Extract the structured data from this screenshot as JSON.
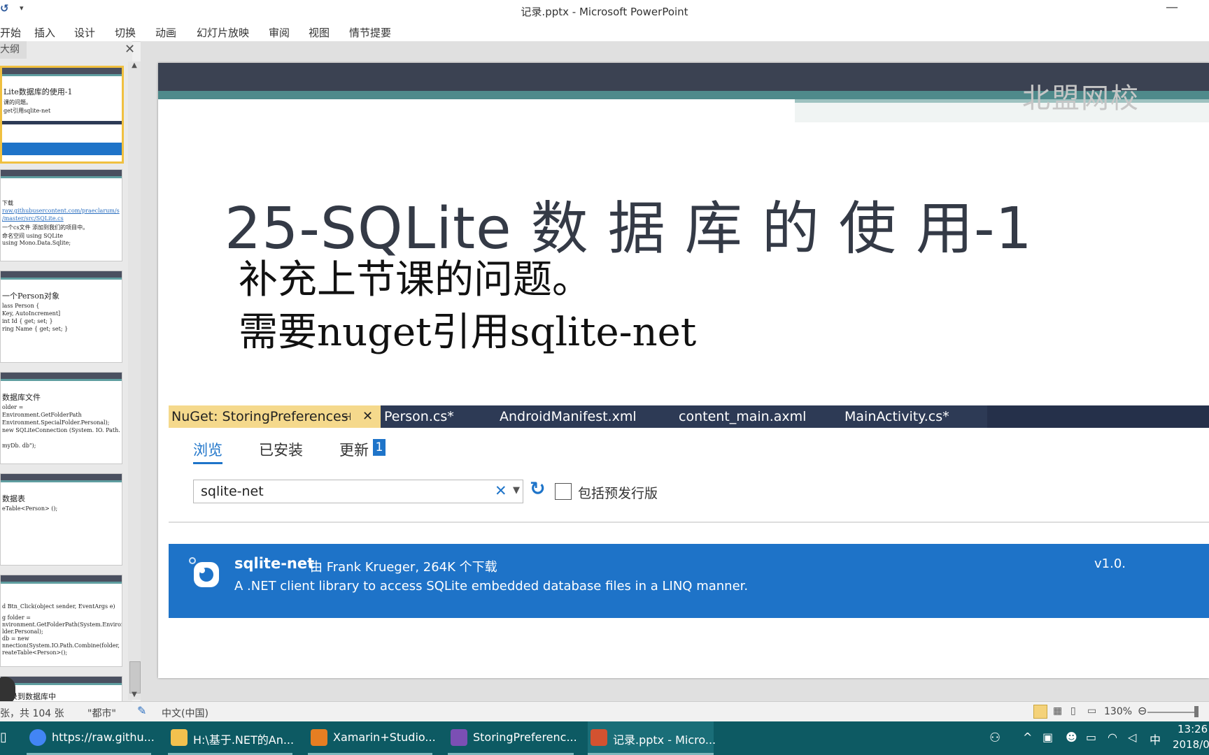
{
  "window": {
    "title": "记录.pptx - Microsoft PowerPoint"
  },
  "ribbon": {
    "tabs": [
      "开始",
      "插入",
      "设计",
      "切换",
      "动画",
      "幻灯片放映",
      "审阅",
      "视图",
      "情节提要"
    ]
  },
  "left_panel": {
    "tab_label": "大纲",
    "thumbs": [
      {
        "lines": [
          "Lite数据库的使用-1",
          "课的问题。",
          "get引用sqlite-net"
        ]
      },
      {
        "lines": [
          "下载",
          "raw.githubusercontent.com/praeclarum/s",
          "/master/src/SQLite.cs",
          "一个cs文件 添加到我们的项目中。",
          "命名空间 using SQLite",
          "using Mono.Data.Sqlite;"
        ]
      },
      {
        "lines": [
          "一个Person对象",
          "lass Person {",
          "Key, AutoIncrement]",
          "int Id { get; set; }",
          "ring Name { get; set; }"
        ]
      },
      {
        "lines": [
          "数据库文件",
          "older =",
          "Environment.GetFolderPath",
          "Environment.SpecialFolder.Personal);",
          "new SQLiteConnection (System. IO. Path.",
          "myDb. db\");"
        ]
      },
      {
        "lines": [
          "数据表",
          "eTable<Person> ();"
        ]
      },
      {
        "lines": [
          "d Btn_Click(object sender, EventArgs e)",
          "g folder =",
          "nvironment.GetFolderPath(System.Environment",
          "lder.Personal);",
          "db = new",
          "nnection(System.IO.Path.Combine(folder,",
          "reateTable<Person>();"
        ]
      },
      {
        "lines": [
          "记录到数据库中"
        ]
      }
    ]
  },
  "slide": {
    "brand": "北盟网校",
    "title": "25-SQLite 数 据 库 的 使 用-1",
    "bullets": [
      "补充上节课的问题。",
      "需要nuget引用sqlite-net"
    ],
    "nuget": {
      "doc_tabs": [
        "NuGet: StoringPreferences",
        "Person.cs*",
        "AndroidManifest.xml",
        "content_main.axml",
        "MainActivity.cs*"
      ],
      "pin_icon": "⊣",
      "nav_tabs": {
        "browse": "浏览",
        "installed": "已安装",
        "updates": "更新",
        "update_count": "1"
      },
      "search_value": "sqlite-net",
      "prerelease_label": "包括预发行版",
      "package": {
        "name": "sqlite-net",
        "meta": "由 Frank Krueger, 264K 个下载",
        "description": "A .NET client library to access SQLite embedded database files in a LINQ manner.",
        "version": "v1.0."
      }
    }
  },
  "status": {
    "slide_info": "张，共 104 张",
    "theme": "\"都市\"",
    "language": "中文(中国)",
    "zoom": "130%"
  },
  "taskbar": {
    "items": [
      {
        "label": "https://raw.githu...",
        "color": "#4285f4"
      },
      {
        "label": "H:\\基于.NET的An...",
        "color": "#f2c14e"
      },
      {
        "label": "Xamarin+Studio...",
        "color": "#e67e22"
      },
      {
        "label": "StoringPreferenc...",
        "color": "#7b4fb4"
      },
      {
        "label": "记录.pptx - Micro...",
        "color": "#d35230"
      }
    ],
    "ime": "中",
    "time": "13:26",
    "date": "2018/0"
  },
  "colors": {
    "nuget_blue": "#1e73c8",
    "slide_band": "#3b4252",
    "taskbar": "#0d5a63"
  }
}
